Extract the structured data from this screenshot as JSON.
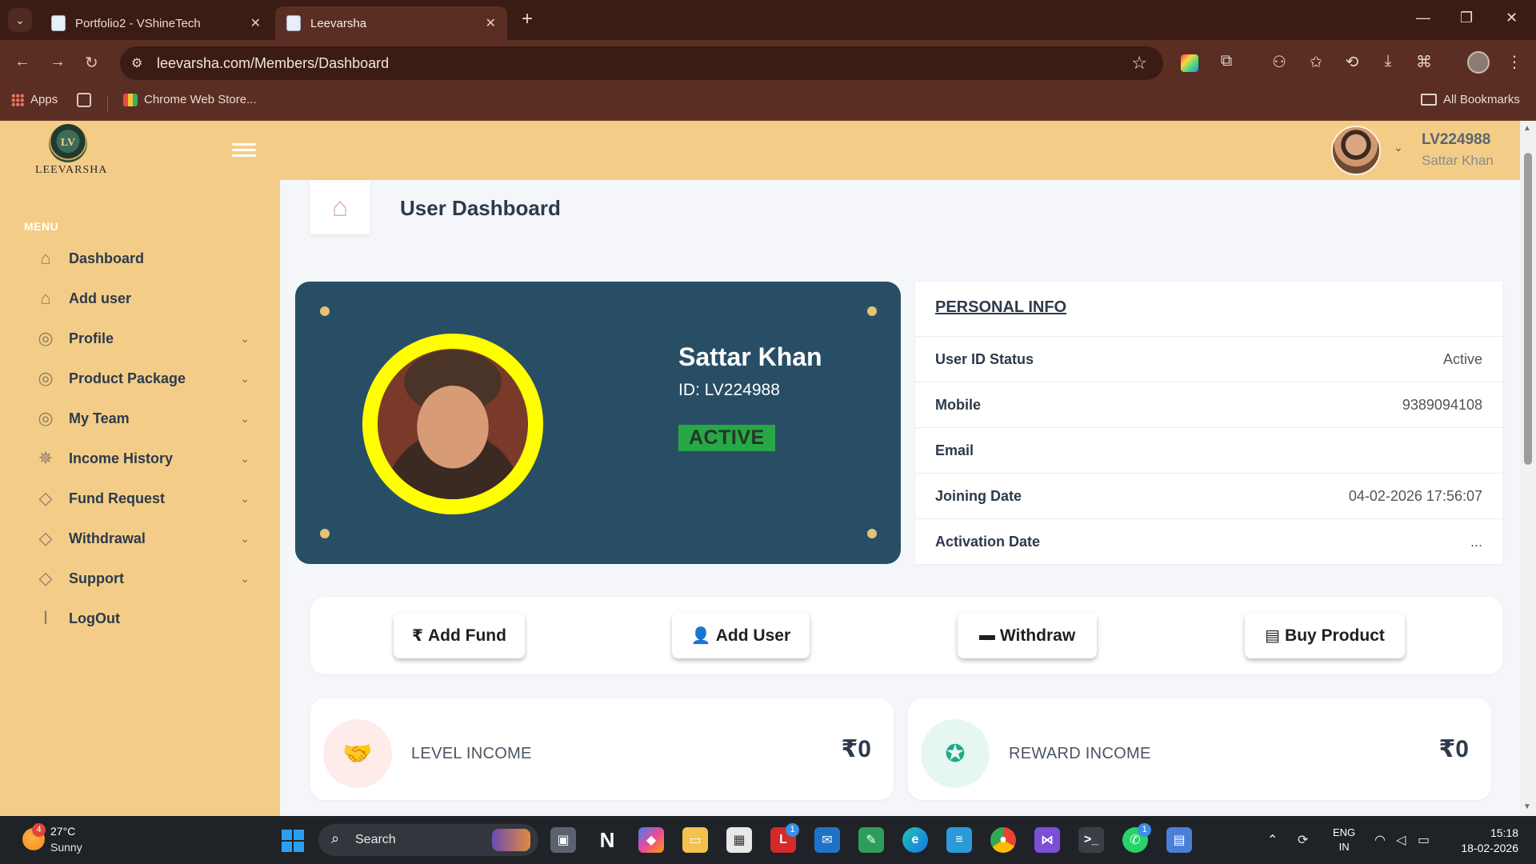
{
  "browser": {
    "tabs": [
      {
        "title": "Portfolio2 - VShineTech",
        "active": false
      },
      {
        "title": "Leevarsha",
        "active": true
      }
    ],
    "url": "leevarsha.com/Members/Dashboard",
    "bookmarks": {
      "apps": "Apps",
      "chrome_web_store": "Chrome Web Store...",
      "all_bookmarks": "All Bookmarks"
    }
  },
  "app": {
    "brand": "LEEVARSHA",
    "brand_emblem": "LV",
    "header": {
      "user_id": "LV224988",
      "user_name": "Sattar Khan"
    },
    "sidebar": {
      "menu_label": "MENU",
      "items": [
        {
          "label": "Dashboard",
          "icon": "home-icon",
          "chevron": false
        },
        {
          "label": "Add user",
          "icon": "home-icon",
          "chevron": false
        },
        {
          "label": "Profile",
          "icon": "user-circle-icon",
          "chevron": true
        },
        {
          "label": "Product Package",
          "icon": "user-circle-icon",
          "chevron": true
        },
        {
          "label": "My Team",
          "icon": "user-circle-icon",
          "chevron": true
        },
        {
          "label": "Income History",
          "icon": "ship-wheel-icon",
          "chevron": true
        },
        {
          "label": "Fund Request",
          "icon": "tag-icon",
          "chevron": true
        },
        {
          "label": "Withdrawal",
          "icon": "tag-icon",
          "chevron": true
        },
        {
          "label": "Support",
          "icon": "tag-icon",
          "chevron": true
        },
        {
          "label": "LogOut",
          "icon": "flashlight-icon",
          "chevron": false
        }
      ]
    },
    "page_title": "User Dashboard",
    "profile_card": {
      "name": "Sattar Khan",
      "id_text": "ID: LV224988",
      "status": "ACTIVE",
      "ring_color": "#ffff00",
      "card_color": "#284e66"
    },
    "personal_info": {
      "heading": "PERSONAL INFO",
      "rows": [
        {
          "key": "User ID Status",
          "value": "Active"
        },
        {
          "key": "Mobile",
          "value": "9389094108"
        },
        {
          "key": "Email",
          "value": ""
        },
        {
          "key": "Joining Date",
          "value": "04-02-2026 17:56:07"
        },
        {
          "key": "Activation Date",
          "value": "..."
        }
      ]
    },
    "actions": [
      {
        "label": "Add Fund",
        "icon": "rupee-icon",
        "glyph": "₹"
      },
      {
        "label": "Add User",
        "icon": "user-plus-icon",
        "glyph": "👤"
      },
      {
        "label": "Withdraw",
        "icon": "wallet-icon",
        "glyph": "▬"
      },
      {
        "label": "Buy Product",
        "icon": "credit-card-icon",
        "glyph": "▤"
      }
    ],
    "income": [
      {
        "label": "LEVEL INCOME",
        "amount": "₹0",
        "icon": "handshake-icon",
        "color": "#e85a4f",
        "bg": "#fdecea"
      },
      {
        "label": "REWARD INCOME",
        "amount": "₹0",
        "icon": "award-icon",
        "color": "#20a98a",
        "bg": "#e6f7f2"
      }
    ],
    "colors": {
      "header_bg": "#f3cd87",
      "sidebar_bg": "#f3cd87",
      "status_green": "#28a745"
    }
  },
  "taskbar": {
    "weather": {
      "temp": "27°C",
      "desc": "Sunny",
      "badge": "4"
    },
    "search_placeholder": "Search",
    "badges": {
      "app_l": "1",
      "whatsapp": "1"
    },
    "lang": {
      "line1": "ENG",
      "line2": "IN"
    },
    "time": "15:18",
    "date": "18-02-2026"
  }
}
